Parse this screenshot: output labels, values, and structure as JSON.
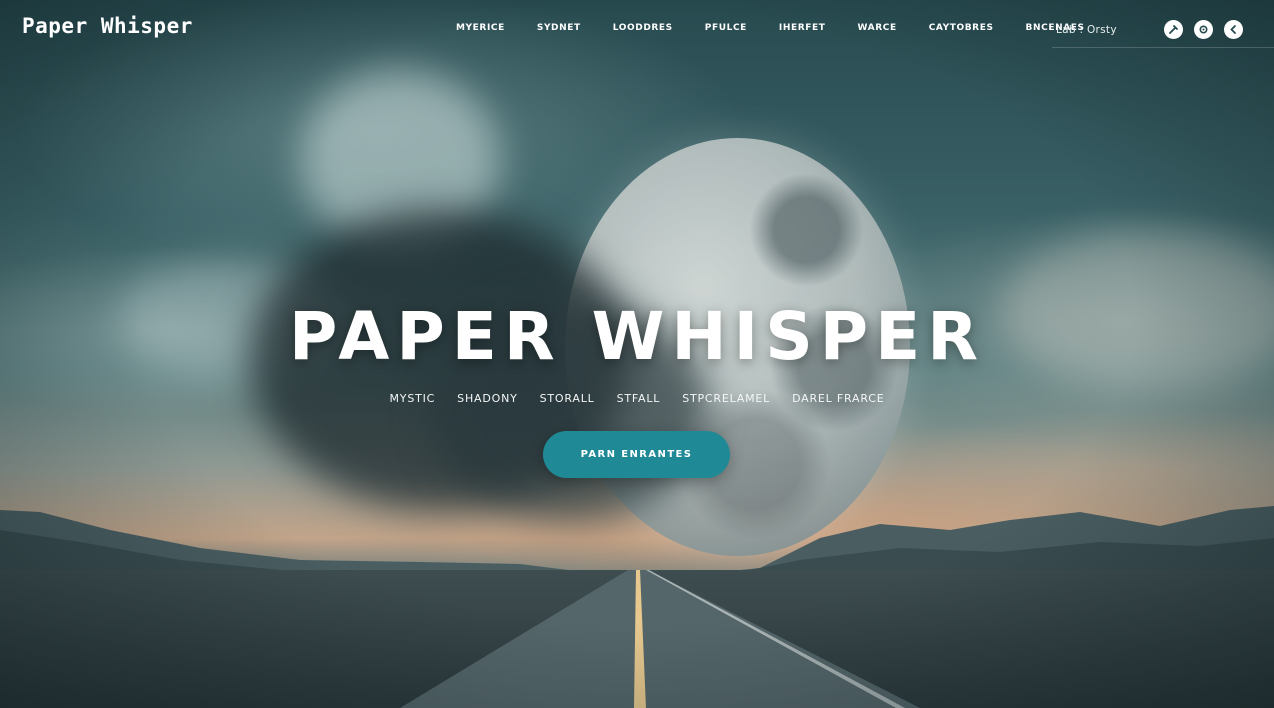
{
  "header": {
    "brand": "Paper Whisper",
    "nav": [
      "MYERICE",
      "SYDNET",
      "LOODDRES",
      "PFULCE",
      "IHERFET",
      "WARCE",
      "CAYTOBRES",
      "BNCENAES"
    ],
    "account_label": "Lab : Orsty",
    "icons": [
      "tools-icon",
      "gear-icon",
      "back-icon"
    ]
  },
  "hero": {
    "title": "PAPER WHISPER",
    "tags": [
      "MYSTIC",
      "SHADONY",
      "STORALL",
      "STFALL",
      "STPCRELAMEL",
      "DAREL FRARCE"
    ],
    "cta_label": "PARN ENRANTES"
  },
  "colors": {
    "accent": "#1f8a95",
    "sky_dark": "#274a4f",
    "horizon": "#c2a489"
  }
}
